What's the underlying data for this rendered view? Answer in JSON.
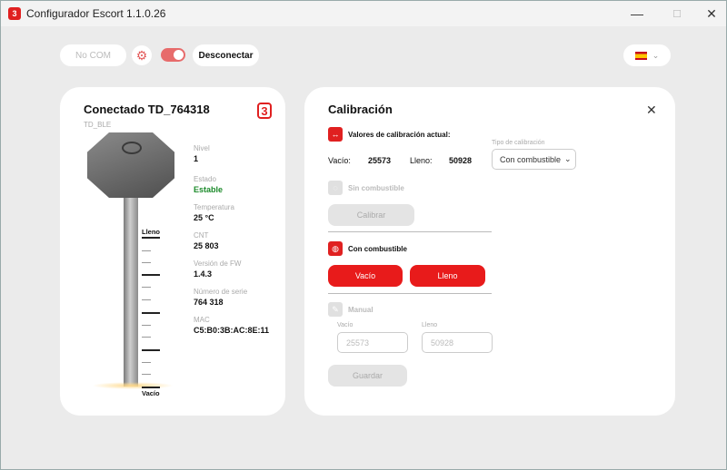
{
  "window": {
    "title": "Configurador Escort 1.1.0.26",
    "app_icon": "escort-logo",
    "minimize": "—",
    "maximize": "☐",
    "close": "✕"
  },
  "toolbar": {
    "com_port": "No COM",
    "disconnect_label": "Desconectar",
    "toggle_on": true,
    "language_flag": "es",
    "accent": "#e76b6b"
  },
  "device": {
    "title": "Conectado  TD_764318",
    "subtitle": "TD_BLE",
    "scale_top": "Lleno",
    "scale_bottom": "Vacío",
    "fields": [
      {
        "label": "Nivel",
        "value": "1"
      },
      {
        "label": "Estado",
        "value": "Estable"
      },
      {
        "label": "Temperatura",
        "value": "25 °C"
      },
      {
        "label": "CNT",
        "value": "25 803"
      },
      {
        "label": "Versión de FW",
        "value": "1.4.3"
      },
      {
        "label": "Número de serie",
        "value": "764 318"
      },
      {
        "label": "MAC",
        "value": "C5:B0:3B:AC:8E:11"
      }
    ],
    "status_color": "#1b8a2a"
  },
  "calibration": {
    "title": "Calibración",
    "current_label": "Valores de calibración actual:",
    "empty_label": "Vacío:",
    "empty_value": "25573",
    "full_label": "Lleno:",
    "full_value": "50928",
    "type_label": "Tipo de calibración",
    "type_value": "Con combustible",
    "no_fuel_label": "Sin combustible",
    "calibrate_button": "Calibrar",
    "with_fuel_label": "Con combustible",
    "empty_button": "Vacío",
    "full_button": "Lleno",
    "manual_label": "Manual",
    "manual_empty_label": "Vacío",
    "manual_empty_value": "25573",
    "manual_full_label": "Lleno",
    "manual_full_value": "50928",
    "save_button": "Guardar",
    "accent": "#e81b1b"
  }
}
